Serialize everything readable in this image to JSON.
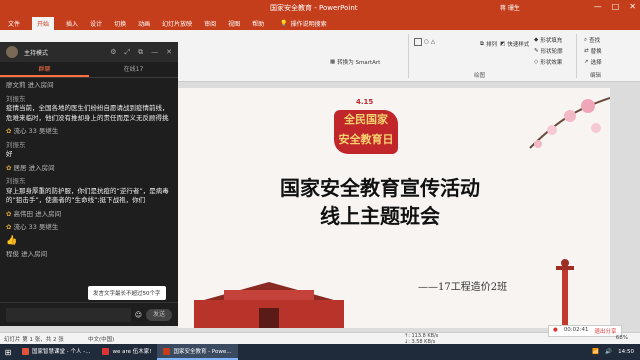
{
  "window": {
    "title": "国家安全教育 - PowerPoint",
    "user": "蒋 珊生",
    "controls": [
      "—",
      "□",
      "✕"
    ]
  },
  "tabs": [
    "文件",
    "开始",
    "插入",
    "设计",
    "切换",
    "动画",
    "幻灯片放映",
    "审阅",
    "视图",
    "帮助"
  ],
  "tell_me": "操作说明搜索",
  "ribbon": {
    "smartart_label": "转换为 SmartArt",
    "drawing_group": "绘图",
    "arrange_label": "排列",
    "quick_styles_label": "快速样式",
    "shape_fill": "形状填充",
    "shape_outline": "形状轮廓",
    "shape_effects": "形状效果",
    "find": "查找",
    "replace": "替换",
    "select": "选择",
    "edit_group": "编辑"
  },
  "chat": {
    "mode": "主持模式",
    "tabs": [
      "群聊",
      "在线17"
    ],
    "messages": [
      {
        "type": "system",
        "text": "廖文莉 进入房间"
      },
      {
        "type": "msg",
        "who": "刘振东",
        "text": "疫情当前，全国各地的医生们纷纷自愿请战到疫情前线，危难来临时，他们没有推却身上的责任而是义无反顾得挑"
      },
      {
        "type": "gift",
        "text": "流心 33 吴继生"
      },
      {
        "type": "msg",
        "who": "刘振东",
        "text": "好"
      },
      {
        "type": "gift",
        "text": "居居 进入房间"
      },
      {
        "type": "msg",
        "who": "刘振东",
        "text": "穿上那身厚重的防护服，你们是抗疫的“逆行者”，是病毒的“狙击手”，使患者的“生命线”;挺下战袍，你们"
      },
      {
        "type": "gift",
        "text": "高伟田 进入房间"
      },
      {
        "type": "gift",
        "text": "流心 33 吴继生"
      },
      {
        "type": "emoji",
        "text": "👍"
      },
      {
        "type": "system",
        "text": "程俊 进入房间"
      }
    ],
    "tooltip": "发言文字最长不超过50个字",
    "input_placeholder": "",
    "send_label": "发送"
  },
  "slide": {
    "date": "4.15",
    "stamp_line1": "全民国家",
    "stamp_line2": "安全教育日",
    "title_line1": "国家安全教育宣传活动",
    "title_line2": "线上主题班会",
    "class_label": "——17工程造价2班"
  },
  "statusbar": {
    "slide_count": "幻灯片 第 1 张，共 2 张",
    "language": "中文(中国)",
    "net_up": "↑: 113.8 KB/s",
    "net_down": "↓: 3.58 KB/s",
    "timer": "00:02:41",
    "exit_share": "退出分享",
    "zoom": "68%"
  },
  "taskbar": {
    "tasks": [
      {
        "label": "国家智慧课堂 - 个人 -...",
        "color": "#e0533b",
        "active": false
      },
      {
        "label": "we are 伍木家!",
        "color": "#d33",
        "active": false
      },
      {
        "label": "国家安全教育 - Powe...",
        "color": "#c43e1c",
        "active": true
      }
    ],
    "time": "14:50"
  }
}
